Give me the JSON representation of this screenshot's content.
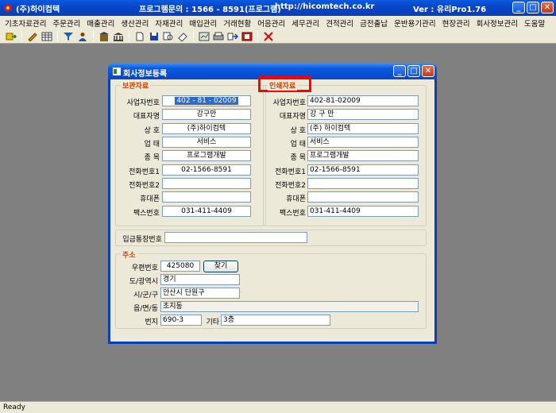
{
  "app": {
    "title": "(주)하이컴텍",
    "contact": "프로그램문의 : 1566 - 8591(프로그램)",
    "website": "http://hicomtech.co.kr",
    "version": "Ver : 유리Pro1.76"
  },
  "window_buttons": {
    "minimize": "_",
    "maximize": "□",
    "close": "✕"
  },
  "menu": [
    "기초자료관리",
    "주문관리",
    "매출관리",
    "생산관리",
    "자재관리",
    "매입관리",
    "거래현황",
    "어음관리",
    "세무관리",
    "견적관리",
    "금전출납",
    "운반용기관리",
    "현장관리",
    "회사정보관리",
    "도움말"
  ],
  "toolbar_icons": [
    "exit-icon",
    "pencil-icon",
    "grid-icon",
    "filter-icon",
    "person-icon",
    "building-icon",
    "bank-icon",
    "new-doc-icon",
    "save-icon",
    "print-preview-icon",
    "eraser-icon",
    "report-icon",
    "printer-icon",
    "export-icon",
    "stop-icon",
    "cancel-icon"
  ],
  "status": "Ready",
  "dialog": {
    "title": "회사정보등록",
    "storage_group": {
      "title": "보관자료",
      "fields": [
        {
          "label": "사업자번호",
          "value": "402 - 81 - 02009"
        },
        {
          "label": "대표자명",
          "value": "강구만"
        },
        {
          "label": "상 호",
          "value": "(주)하이컴텍"
        },
        {
          "label": "업 태",
          "value": "서비스"
        },
        {
          "label": "종 목",
          "value": "프로그램개발"
        },
        {
          "label": "전화번호1",
          "value": "02-1566-8591"
        },
        {
          "label": "전화번호2",
          "value": ""
        },
        {
          "label": "휴대폰",
          "value": ""
        },
        {
          "label": "팩스번호",
          "value": "031-411-4409"
        }
      ]
    },
    "print_group": {
      "title": "인쇄자료",
      "fields": [
        {
          "label": "사업자번호",
          "value": "402-81-02009"
        },
        {
          "label": "대표자명",
          "value": "강 구 만"
        },
        {
          "label": "상 호",
          "value": "(주) 하이컴텍"
        },
        {
          "label": "업 태",
          "value": "서비스"
        },
        {
          "label": "종 목",
          "value": "프로그램개발"
        },
        {
          "label": "전화번호1",
          "value": "02-1566-8591"
        },
        {
          "label": "전화번호2",
          "value": ""
        },
        {
          "label": "휴대폰",
          "value": ""
        },
        {
          "label": "팩스번호",
          "value": "031-411-4409"
        }
      ]
    },
    "deposit": {
      "label": "입금통장번호",
      "value": ""
    },
    "address": {
      "title": "주소",
      "postcode_label": "우편번호",
      "postcode": "425080",
      "find_button": "찾기",
      "province_label": "도/광역시",
      "province": "경기",
      "city_label": "시/군/구",
      "city": "안산시 단원구",
      "town_label": "읍/면/동",
      "town": "초지동",
      "lot_label": "번지",
      "lot": "690-3",
      "etc_label": "기타",
      "etc": "3층"
    }
  }
}
